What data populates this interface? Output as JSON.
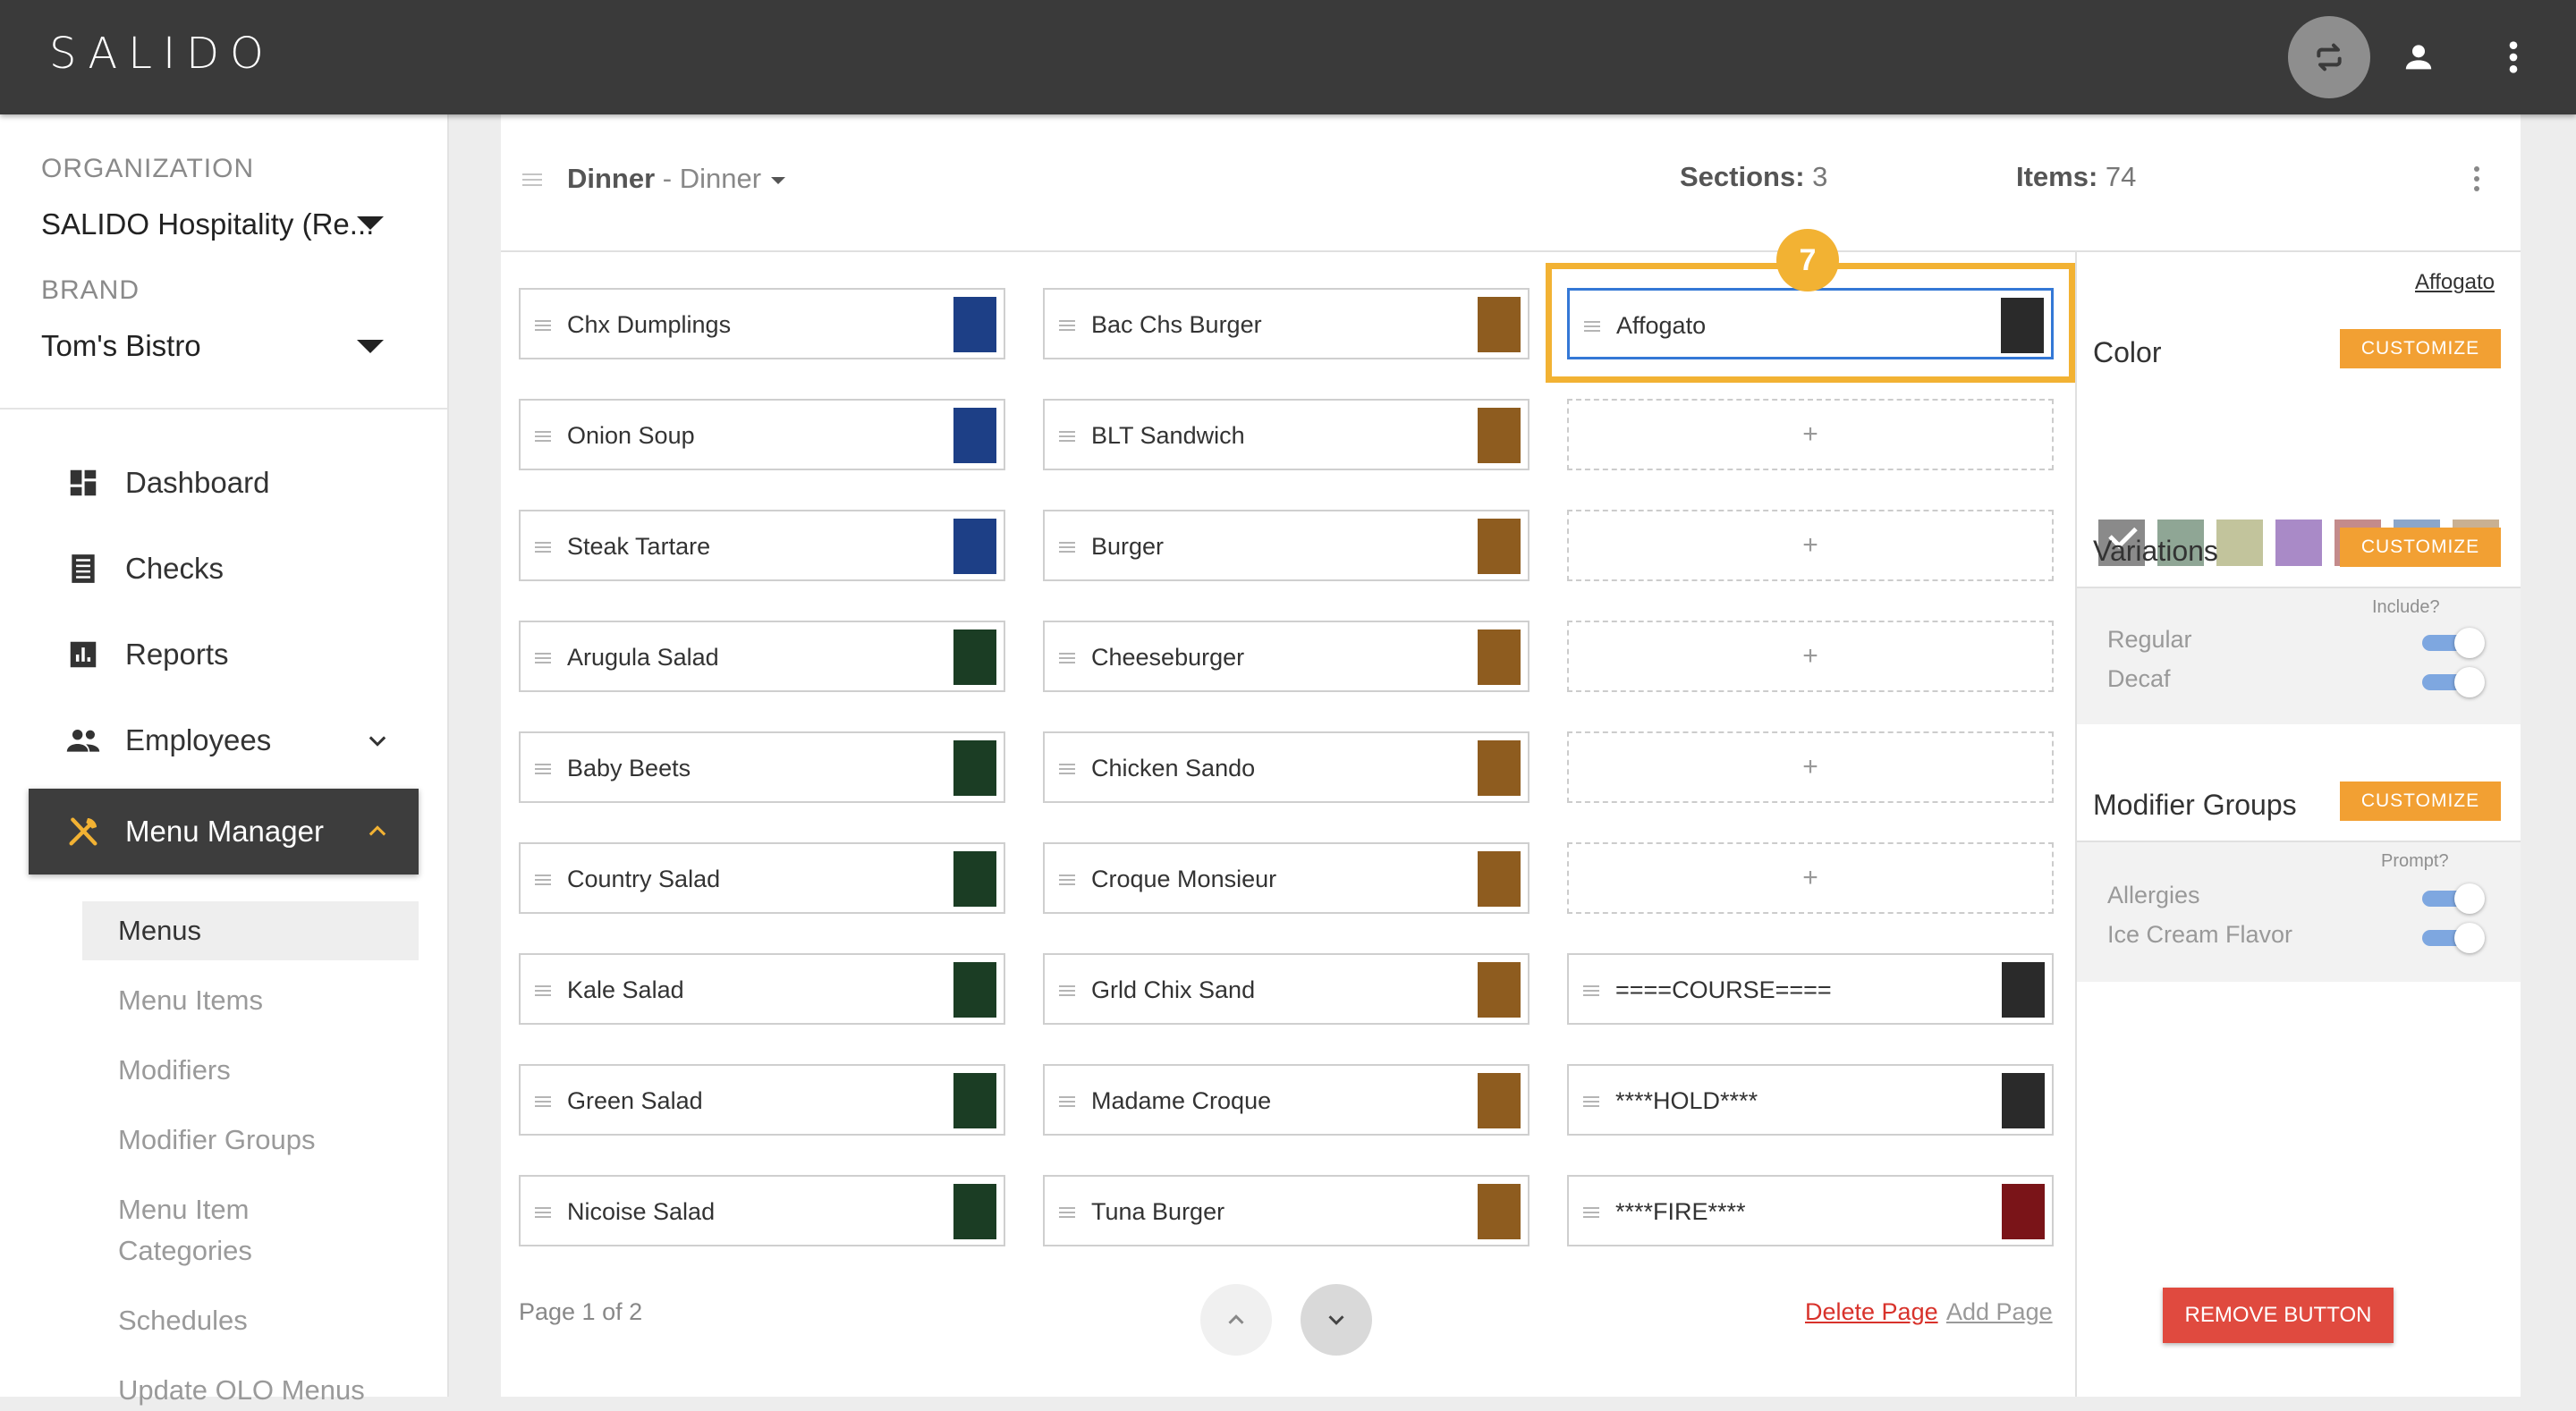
{
  "app": {
    "logo": "SALIDO"
  },
  "sidebar": {
    "organization_label": "ORGANIZATION",
    "organization_value": "SALIDO Hospitality (Re...",
    "brand_label": "BRAND",
    "brand_value": "Tom's Bistro",
    "nav": [
      {
        "label": "Dashboard",
        "icon": "dashboard-icon"
      },
      {
        "label": "Checks",
        "icon": "checks-icon"
      },
      {
        "label": "Reports",
        "icon": "reports-icon"
      },
      {
        "label": "Employees",
        "icon": "employees-icon"
      },
      {
        "label": "Menu Manager",
        "icon": "menu-manager-icon"
      }
    ],
    "subnav": [
      "Menus",
      "Menu Items",
      "Modifiers",
      "Modifier Groups",
      "Menu Item",
      "Categories",
      "Schedules",
      "Update OLO Menus"
    ]
  },
  "header": {
    "menu_name": "Dinner",
    "menu_sub": " - Dinner",
    "sections_label": "Sections:",
    "sections_value": " 3",
    "items_label": "Items:",
    "items_value": " 74"
  },
  "grid": {
    "col1": [
      {
        "name": "Chx Dumplings",
        "color": "#1d3f86"
      },
      {
        "name": "Onion Soup",
        "color": "#1d3f86"
      },
      {
        "name": "Steak Tartare",
        "color": "#1d3f86"
      },
      {
        "name": "Arugula Salad",
        "color": "#1b3d24"
      },
      {
        "name": "Baby Beets",
        "color": "#1b3d24"
      },
      {
        "name": "Country Salad",
        "color": "#1b3d24"
      },
      {
        "name": "Kale Salad",
        "color": "#1b3d24"
      },
      {
        "name": "Green Salad",
        "color": "#1b3d24"
      },
      {
        "name": "Nicoise Salad",
        "color": "#1b3d24"
      }
    ],
    "col2": [
      {
        "name": "Bac Chs Burger",
        "color": "#8e5c1f"
      },
      {
        "name": "BLT Sandwich",
        "color": "#8e5c1f"
      },
      {
        "name": "Burger",
        "color": "#8e5c1f"
      },
      {
        "name": "Cheeseburger",
        "color": "#8e5c1f"
      },
      {
        "name": "Chicken Sando",
        "color": "#8e5c1f"
      },
      {
        "name": "Croque Monsieur",
        "color": "#8e5c1f"
      },
      {
        "name": "Grld Chix Sand",
        "color": "#8e5c1f"
      },
      {
        "name": "Madame Croque",
        "color": "#8e5c1f"
      },
      {
        "name": "Tuna Burger",
        "color": "#8e5c1f"
      }
    ],
    "col3": [
      {
        "name": "Affogato",
        "color": "#2a2a2a"
      },
      {
        "name": "+"
      },
      {
        "name": "+"
      },
      {
        "name": "+"
      },
      {
        "name": "+"
      },
      {
        "name": "+"
      },
      {
        "name": "====COURSE====",
        "color": "#2a2a2a"
      },
      {
        "name": "****HOLD****",
        "color": "#2a2a2a"
      },
      {
        "name": "****FIRE****",
        "color": "#7a1418"
      }
    ],
    "empty_label": "+",
    "step_badge": "7"
  },
  "footer": {
    "page_text": "Page 1 of 2",
    "delete_page": "Delete Page",
    "add_page": "Add Page"
  },
  "right_panel": {
    "selected_link": "Affogato",
    "color_label": "Color",
    "customize": "CUSTOMIZE",
    "swatches": [
      "#8a8a8a",
      "#8fa695",
      "#c2c49c",
      "#a98ac7",
      "#c48b8b",
      "#8ba6c9",
      "#c9b092"
    ],
    "variations_label": "Variations",
    "variations_col": "Include?",
    "variations": [
      "Regular",
      "Decaf"
    ],
    "modifier_groups_label": "Modifier Groups",
    "modifier_groups_col": "Prompt?",
    "modifier_groups": [
      "Allergies",
      "Ice Cream Flavor"
    ],
    "remove_button": "REMOVE BUTTON"
  },
  "colors": {
    "accent": "#f2b233",
    "customize": "#f2a033",
    "danger": "#e04a3f",
    "selection": "#3478d6"
  }
}
